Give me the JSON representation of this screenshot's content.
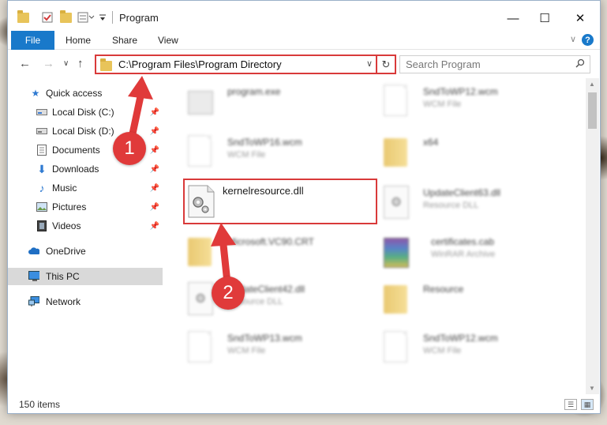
{
  "window": {
    "title": "Program",
    "controls": {
      "minimize": "—",
      "maximize": "☐",
      "close": "✕"
    }
  },
  "ribbon": {
    "tabs": [
      {
        "label": "File",
        "active": true
      },
      {
        "label": "Home"
      },
      {
        "label": "Share"
      },
      {
        "label": "View"
      }
    ],
    "help": "?"
  },
  "address": {
    "path": "C:\\Program Files\\Program Directory",
    "search_placeholder": "Search Program"
  },
  "sidebar": {
    "items": [
      {
        "label": "Quick access",
        "icon": "star-icon"
      },
      {
        "label": "Local Disk (C:)",
        "icon": "drive-icon",
        "pinned": true
      },
      {
        "label": "Local Disk (D:)",
        "icon": "drive-icon",
        "pinned": true
      },
      {
        "label": "Documents",
        "icon": "documents-icon",
        "pinned": true
      },
      {
        "label": "Downloads",
        "icon": "downloads-icon",
        "pinned": true
      },
      {
        "label": "Music",
        "icon": "music-icon",
        "pinned": true
      },
      {
        "label": "Pictures",
        "icon": "pictures-icon",
        "pinned": true
      },
      {
        "label": "Videos",
        "icon": "videos-icon",
        "pinned": true
      },
      {
        "label": "OneDrive",
        "icon": "cloud-icon"
      },
      {
        "label": "This PC",
        "icon": "computer-icon",
        "selected": true
      },
      {
        "label": "Network",
        "icon": "network-icon"
      }
    ]
  },
  "files": [
    {
      "name": "program.exe",
      "type": "",
      "icon": "exe-icon"
    },
    {
      "name": "SndToWP12.wcm",
      "type": "WCM File",
      "icon": "document-icon"
    },
    {
      "name": "SndToWP16.wcm",
      "type": "WCM File",
      "icon": "document-icon"
    },
    {
      "name": "x64",
      "type": "",
      "icon": "folder-icon"
    },
    {
      "name": "kernelresource.dll",
      "type": "",
      "icon": "dll-icon",
      "highlighted": true
    },
    {
      "name": "UpdateClient63.dll",
      "type": "Resource DLL",
      "icon": "dll-icon"
    },
    {
      "name": "Microsoft.VC90.CRT",
      "type": "",
      "icon": "folder-icon"
    },
    {
      "name": "certificates.cab",
      "type": "WinRAR Archive",
      "icon": "archive-icon"
    },
    {
      "name": "UpdateClient42.dll",
      "type": "Resource DLL",
      "icon": "dll-icon"
    },
    {
      "name": "Resource",
      "type": "",
      "icon": "folder-icon"
    },
    {
      "name": "SndToWP13.wcm",
      "type": "WCM File",
      "icon": "document-icon"
    },
    {
      "name": "SndToWP12.wcm",
      "type": "WCM File",
      "icon": "document-icon"
    }
  ],
  "status": {
    "count": "150 items"
  },
  "annotations": {
    "step1": "1",
    "step2": "2"
  },
  "colors": {
    "accent": "#1979ca",
    "annotation": "#e03a3a"
  }
}
